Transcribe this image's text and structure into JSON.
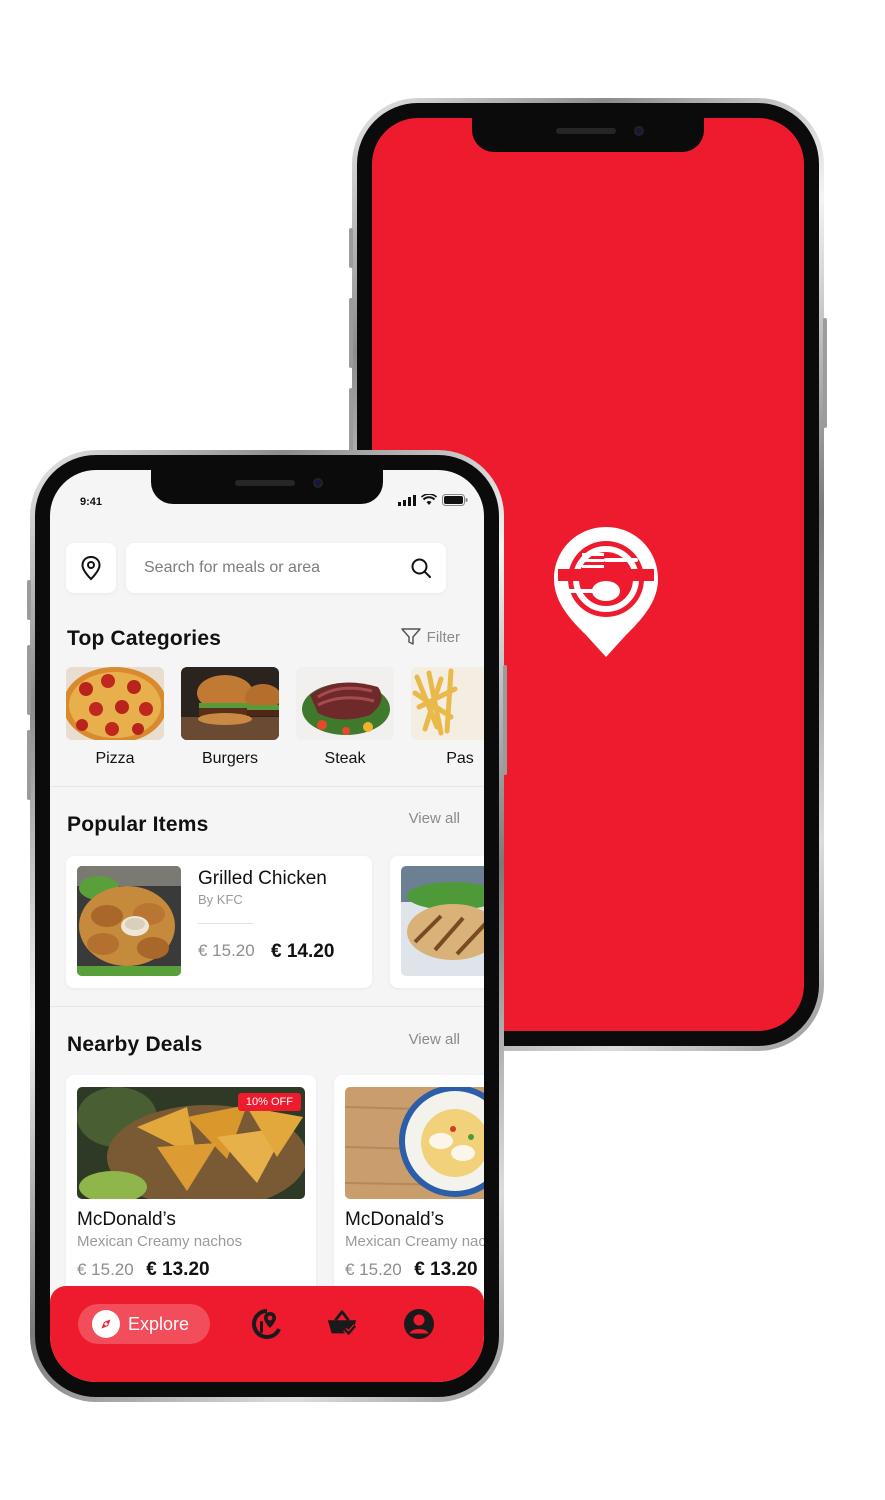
{
  "status_bar": {
    "time": "9:41"
  },
  "search": {
    "placeholder": "Search for meals or area"
  },
  "categories": {
    "title": "Top Categories",
    "filter_label": "Filter",
    "items": [
      {
        "label": "Pizza"
      },
      {
        "label": "Burgers"
      },
      {
        "label": "Steak"
      },
      {
        "label": "Pas"
      }
    ]
  },
  "popular": {
    "title": "Popular Items",
    "view_all": "View all",
    "items": [
      {
        "name": "Grilled Chicken",
        "by": "By KFC",
        "old_price": "€ 15.20",
        "new_price": "€ 14.20"
      }
    ]
  },
  "deals": {
    "title": "Nearby Deals",
    "view_all": "View all",
    "items": [
      {
        "name": "McDonald’s",
        "desc": "Mexican Creamy nachos",
        "badge": "10% OFF",
        "old_price": "€ 15.20",
        "new_price": "€ 13.20"
      },
      {
        "name": "McDonald’s",
        "desc": "Mexican Creamy nachos",
        "old_price": "€ 15.20",
        "new_price": "€ 13.20"
      }
    ]
  },
  "bottom_nav": {
    "items": [
      {
        "label": "Explore",
        "icon": "compass-icon",
        "active": true
      },
      {
        "icon": "food-location-icon"
      },
      {
        "icon": "basket-icon"
      },
      {
        "icon": "profile-icon"
      }
    ]
  },
  "colors": {
    "brand": "#ee1b2e",
    "background": "#f6f5f5",
    "card": "#ffffff"
  }
}
